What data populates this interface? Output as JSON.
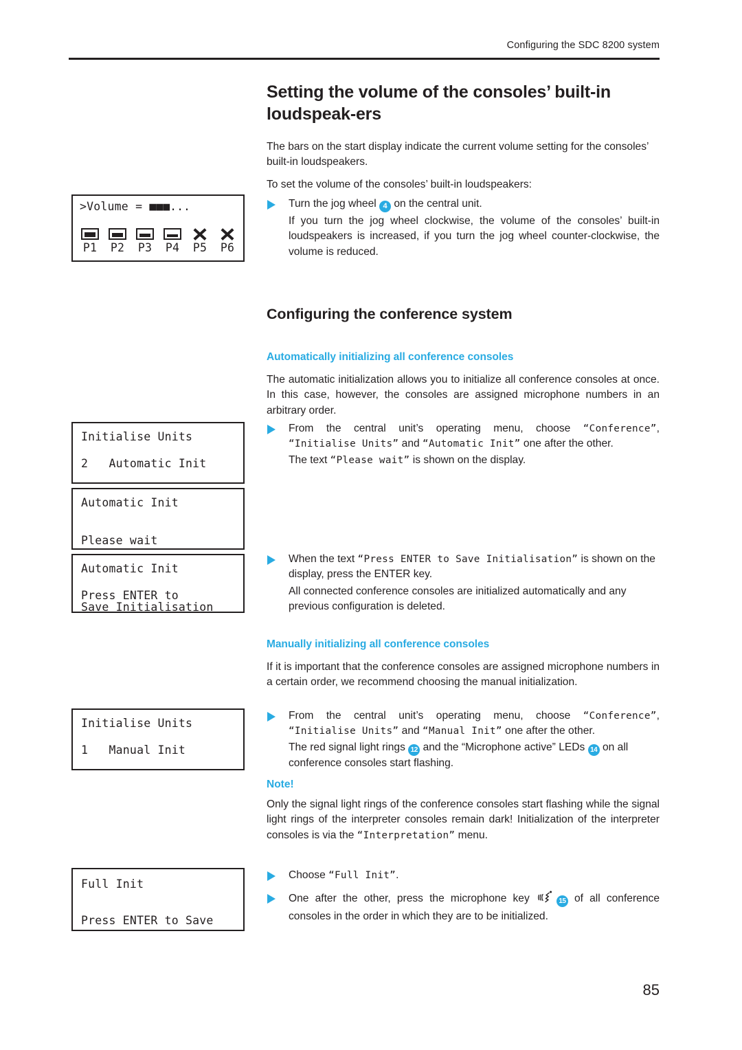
{
  "header": {
    "running_head": "Configuring the SDC 8200 system"
  },
  "page_number": "85",
  "colors": {
    "accent": "#29abe2",
    "text": "#231f20"
  },
  "sections": {
    "volume": {
      "title": "Setting the volume of the consoles’ built-in loudspeak-ers",
      "para1": "The bars on the start display indicate the current volume setting for the consoles’ built-in loudspeakers.",
      "para2": "To set the volume of the consoles’ built-in loudspeakers:",
      "bullet1_pre": "Turn the jog wheel ",
      "bullet1_badge": "4",
      "bullet1_post": " on the central unit.",
      "bullet1_detail": "If you turn the jog wheel clockwise, the volume of the consoles’ built-in loudspeakers is increased, if you turn the jog wheel counter-clockwise, the volume is reduced."
    },
    "conference": {
      "title": "Configuring the conference system",
      "auto": {
        "heading": "Automatically initializing all conference consoles",
        "para": "The automatic initialization allows you to initialize all conference consoles at once. In this case, however, the consoles are assigned microphone numbers in an arbitrary order.",
        "b1_t1": "From the central unit’s operating menu, choose ",
        "b1_c1": "“Conference”",
        "b1_t2": ", ",
        "b1_c2": "“Initialise Units”",
        "b1_t3": " and ",
        "b1_c3": "“Automatic Init”",
        "b1_t4": " one after the other.",
        "b1_t5": "The text ",
        "b1_c4": "“Please wait”",
        "b1_t6": " is shown on the display.",
        "b2_t1": "When the text ",
        "b2_c1": "“Press ENTER to Save Initialisation”",
        "b2_t2": " is shown on the display, press the ENTER key.",
        "b2_t3": "All connected conference consoles are initialized automatically and any previous configuration is deleted."
      },
      "manual": {
        "heading": "Manually initializing all conference consoles",
        "para": "If it is important that the conference consoles are assigned microphone numbers in a certain order, we recommend choosing the manual initialization.",
        "b1_t1": "From the central unit’s operating menu, choose ",
        "b1_c1": "“Conference”",
        "b1_t2": ", ",
        "b1_c2": "“Initialise Units”",
        "b1_t3": " and ",
        "b1_c3": "“Manual Init”",
        "b1_t4": " one after the other.",
        "b1_t5": "The red signal light rings ",
        "b1_badge1": "12",
        "b1_t6": " and the “Microphone active” LEDs ",
        "b1_badge2": "14",
        "b1_t7": " on all conference consoles start flashing.",
        "note_label": "Note!",
        "note_t1": "Only the signal light rings of the conference consoles start flashing while the signal light rings of the interpreter consoles remain dark! Initialization of the interpreter consoles is via the ",
        "note_c1": "“Interpretation”",
        "note_t2": " menu.",
        "b2_t1": "Choose ",
        "b2_c1": "“Full Init”",
        "b2_t2": ".",
        "b3_t1": "One after the other, press the microphone key ",
        "b3_badge": "15",
        "b3_t2": " of all conference consoles in the order in which they are to be initialized."
      }
    }
  },
  "lcd_displays": {
    "volume": {
      "line1": ">Volume = ",
      "volume_blocks": "■■■...",
      "ports": [
        {
          "label": "P1",
          "icon": "port-box",
          "fill": 7
        },
        {
          "label": "P2",
          "icon": "port-box",
          "fill": 6
        },
        {
          "label": "P3",
          "icon": "port-box",
          "fill": 5
        },
        {
          "label": "P4",
          "icon": "port-box",
          "fill": 4
        },
        {
          "label": "P5",
          "icon": "port-x",
          "fill": 0
        },
        {
          "label": "P6",
          "icon": "port-x",
          "fill": 0
        }
      ]
    },
    "init_units_auto": {
      "line1": "Initialise Units",
      "line2": "2   Automatic Init"
    },
    "automatic_wait": {
      "line1": "Automatic Init",
      "line2": "Please wait"
    },
    "automatic_save": {
      "line1": "Automatic Init",
      "line2": "Press ENTER to",
      "line3": "Save Initialisation"
    },
    "init_units_manual": {
      "line1": "Initialise Units",
      "line2": "1   Manual Init"
    },
    "full_init": {
      "line1": "Full Init",
      "line2": "Press ENTER to Save"
    }
  }
}
